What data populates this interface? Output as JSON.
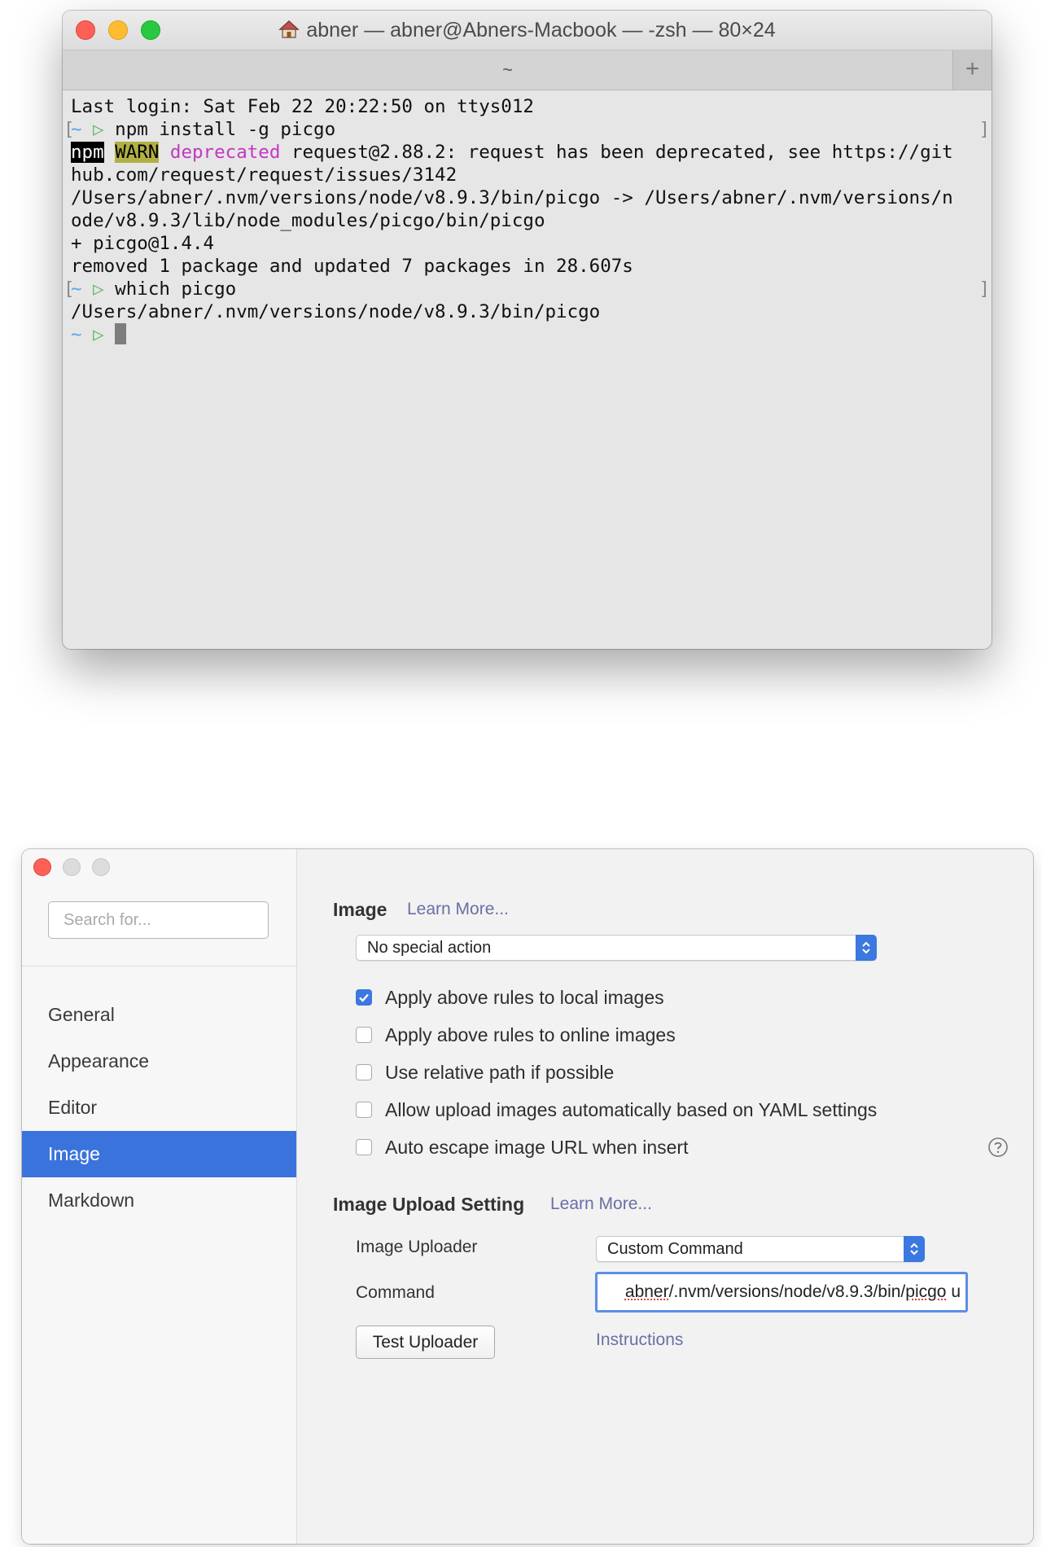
{
  "terminal": {
    "title": "abner — abner@Abners-Macbook — -zsh — 80×24",
    "tab_label": "~",
    "tab_add": "+",
    "lines": {
      "l1": "Last login: Sat Feb 22 20:22:50 on ttys012",
      "l2_prompt_tilde": "~",
      "l2_prompt_arrow": "▷",
      "l2_cmd": " npm install -g picgo",
      "l3_npm": "npm",
      "l3_warn": "WARN",
      "l3_dep": "deprecated",
      "l3_rest": " request@2.88.2: request has been deprecated, see https://git",
      "l4": "hub.com/request/request/issues/3142",
      "l5": "/Users/abner/.nvm/versions/node/v8.9.3/bin/picgo -> /Users/abner/.nvm/versions/n",
      "l6": "ode/v8.9.3/lib/node_modules/picgo/bin/picgo",
      "l7": "+ picgo@1.4.4",
      "l8": "removed 1 package and updated 7 packages in 28.607s",
      "l9_cmd": " which picgo",
      "l10": "/Users/abner/.nvm/versions/node/v8.9.3/bin/picgo"
    },
    "bracket_left": "[",
    "bracket_right": "]"
  },
  "prefs": {
    "search_placeholder": "Search for...",
    "sidebar": [
      {
        "label": "General"
      },
      {
        "label": "Appearance"
      },
      {
        "label": "Editor"
      },
      {
        "label": "Image"
      },
      {
        "label": "Markdown"
      }
    ],
    "image_section": {
      "title": "Image",
      "learn_more": "Learn More...",
      "action_select": "No special action",
      "checkboxes": [
        {
          "label": "Apply above rules to local images",
          "checked": true
        },
        {
          "label": "Apply above rules to online images",
          "checked": false
        },
        {
          "label": "Use relative path if possible",
          "checked": false
        },
        {
          "label": "Allow upload images automatically based on YAML settings",
          "checked": false
        },
        {
          "label": "Auto escape image URL when insert",
          "checked": false
        }
      ]
    },
    "upload_section": {
      "title": "Image Upload Setting",
      "learn_more": "Learn More...",
      "uploader_label": "Image Uploader",
      "uploader_value": "Custom Command",
      "command_label": "Command",
      "command_value_a": "abner",
      "command_value_b": "/.nvm/versions/node/v8.9.3/bin/",
      "command_value_c": "picgo",
      "command_value_d": " u",
      "test_button": "Test Uploader",
      "instructions": "Instructions"
    }
  },
  "colors": {
    "accent": "#3b73dd",
    "link": "#6a6fa6",
    "prompt_tilde": "#5aa6e8",
    "prompt_arrow": "#5cb85c",
    "deprecated": "#c237c2",
    "warn_bg": "#b2b044"
  }
}
